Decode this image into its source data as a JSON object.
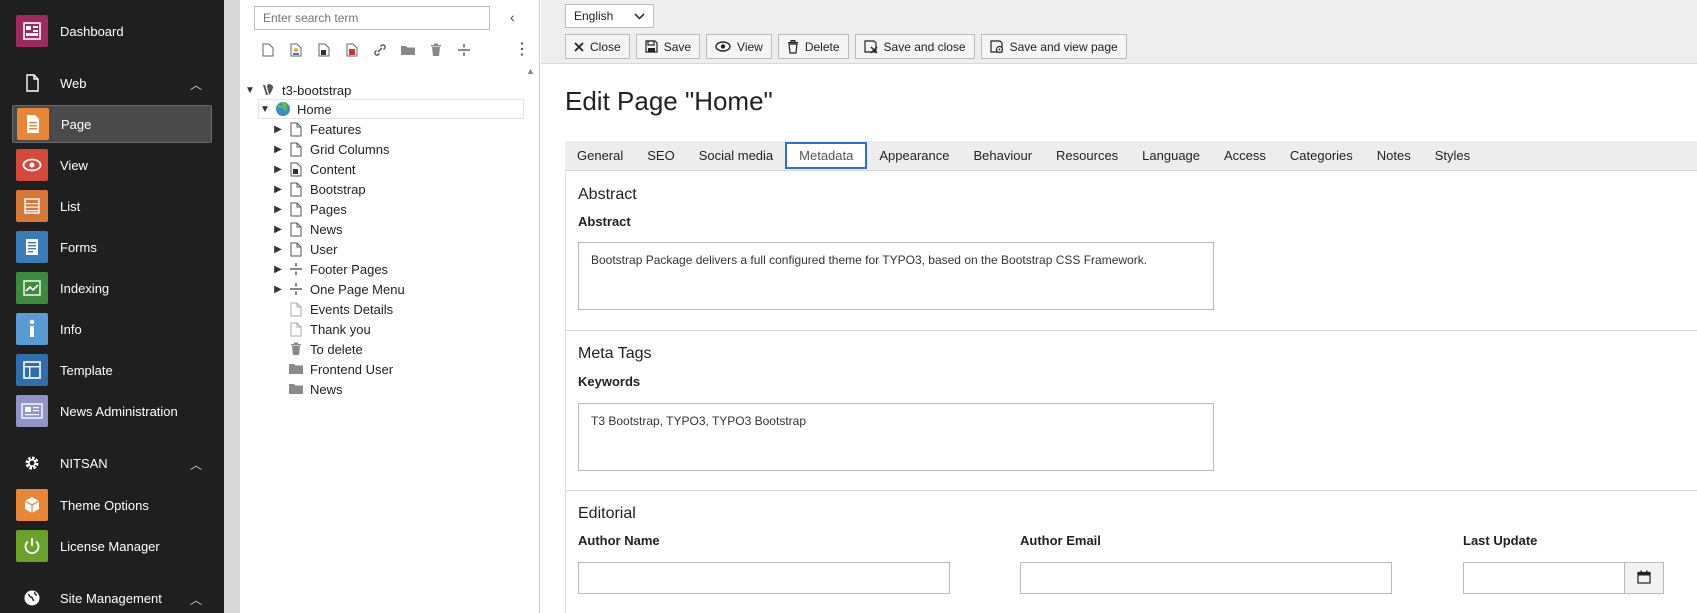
{
  "module_menu": {
    "items": [
      {
        "label": "Dashboard",
        "color": "#9c2a5d"
      },
      {
        "label": "Page",
        "color": "#e8863a"
      },
      {
        "label": "View",
        "color": "#d44a3a"
      },
      {
        "label": "List",
        "color": "#d8773a"
      },
      {
        "label": "Forms",
        "color": "#3b7cb8"
      },
      {
        "label": "Indexing",
        "color": "#3e8a3e"
      },
      {
        "label": "Info",
        "color": "#5b9bd5"
      },
      {
        "label": "Template",
        "color": "#2f6ea8"
      },
      {
        "label": "News Administration",
        "color": "#8f95c9"
      },
      {
        "label": "Theme Options",
        "color": "#e8863a"
      },
      {
        "label": "License Manager",
        "color": "#6aa12a"
      }
    ],
    "groups": [
      {
        "label": "Web"
      },
      {
        "label": "NITSAN"
      },
      {
        "label": "Site Management"
      }
    ]
  },
  "page_tree": {
    "search_placeholder": "Enter search term",
    "root": "t3-bootstrap",
    "home": "Home",
    "children": [
      {
        "label": "Features",
        "icon": "page-icon",
        "expandable": true
      },
      {
        "label": "Grid Columns",
        "icon": "page-icon",
        "expandable": true
      },
      {
        "label": "Content",
        "icon": "shortcut-page-icon",
        "expandable": true
      },
      {
        "label": "Bootstrap",
        "icon": "page-icon",
        "expandable": true
      },
      {
        "label": "Pages",
        "icon": "page-icon",
        "expandable": true
      },
      {
        "label": "News",
        "icon": "page-icon",
        "expandable": true
      },
      {
        "label": "User",
        "icon": "page-icon",
        "expandable": true
      },
      {
        "label": "Footer Pages",
        "icon": "divider-icon",
        "expandable": true
      },
      {
        "label": "One Page Menu",
        "icon": "divider-icon",
        "expandable": true
      },
      {
        "label": "Events Details",
        "icon": "page-light-icon",
        "expandable": false
      },
      {
        "label": "Thank you",
        "icon": "page-light-icon",
        "expandable": false
      },
      {
        "label": "To delete",
        "icon": "trash-icon",
        "expandable": false
      },
      {
        "label": "Frontend User",
        "icon": "folder-icon",
        "expandable": false
      },
      {
        "label": "News",
        "icon": "folder-icon",
        "expandable": false
      }
    ]
  },
  "header": {
    "language": "English",
    "buttons": {
      "close": "Close",
      "save": "Save",
      "view": "View",
      "delete": "Delete",
      "save_close": "Save and close",
      "save_view": "Save and view page"
    }
  },
  "page_title": "Edit Page \"Home\"",
  "tabs": [
    "General",
    "SEO",
    "Social media",
    "Metadata",
    "Appearance",
    "Behaviour",
    "Resources",
    "Language",
    "Access",
    "Categories",
    "Notes",
    "Styles"
  ],
  "active_tab": "Metadata",
  "sections": {
    "abstract": {
      "title": "Abstract",
      "field_label": "Abstract",
      "value": "Bootstrap Package delivers a full configured theme for TYPO3, based on the Bootstrap CSS Framework."
    },
    "meta_tags": {
      "title": "Meta Tags",
      "field_label": "Keywords",
      "value": "T3 Bootstrap, TYPO3, TYPO3 Bootstrap"
    },
    "editorial": {
      "title": "Editorial",
      "author_name_label": "Author Name",
      "author_email_label": "Author Email",
      "last_update_label": "Last Update"
    }
  },
  "colors": {
    "sidebar_bg": "#1f1f1f",
    "accent": "#2f6fcf"
  }
}
